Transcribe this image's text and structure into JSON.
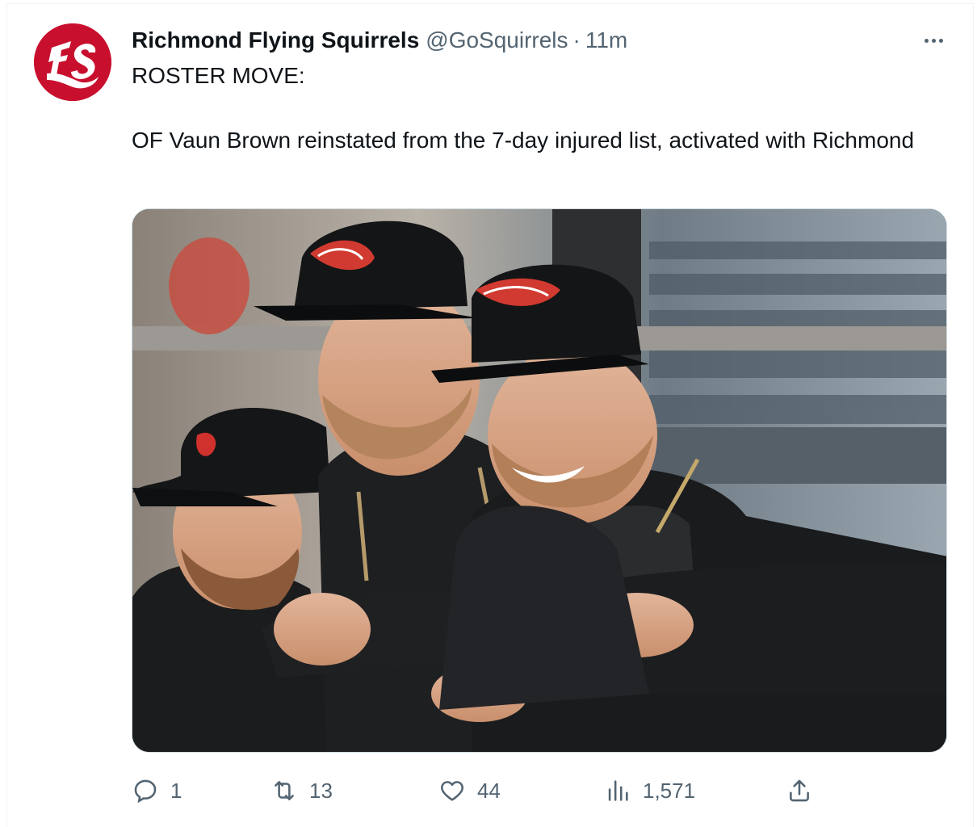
{
  "tweet": {
    "author_name": "Richmond Flying Squirrels",
    "handle": "@GoSquirrels",
    "separator": "·",
    "time": "11m",
    "text": "ROSTER MOVE:\n\nOF Vaun Brown reinstated from the 7-day injured list, activated with Richmond",
    "avatar_icon": "flying-squirrels-logo",
    "brand_color": "#c8102e"
  },
  "media": {
    "image_description_icon": "photo-players-in-dugout"
  },
  "actions": {
    "reply": {
      "icon": "reply-icon",
      "count": "1"
    },
    "retweet": {
      "icon": "retweet-icon",
      "count": "13"
    },
    "like": {
      "icon": "heart-icon",
      "count": "44"
    },
    "views": {
      "icon": "views-icon",
      "count": "1,571"
    },
    "share": {
      "icon": "share-icon"
    }
  },
  "colors": {
    "text_primary": "#0f1419",
    "text_secondary": "#536471",
    "border": "#cfd9de"
  }
}
